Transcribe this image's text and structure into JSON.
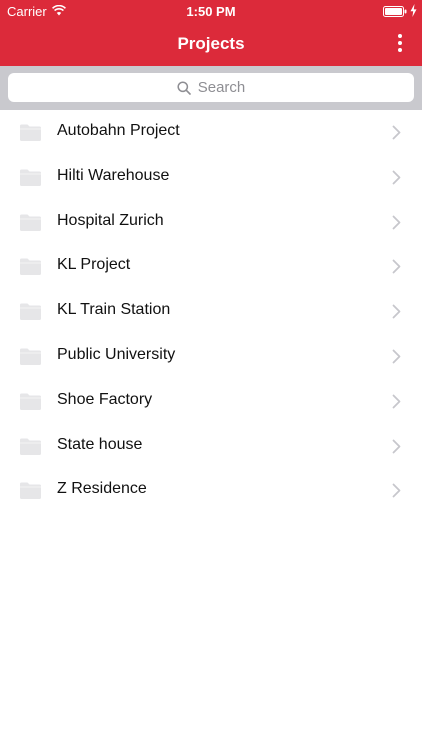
{
  "status_bar": {
    "carrier": "Carrier",
    "time": "1:50 PM"
  },
  "nav": {
    "title": "Projects",
    "more_icon": "more-vertical-icon"
  },
  "search": {
    "placeholder": "Search"
  },
  "projects": [
    {
      "label": "Autobahn Project"
    },
    {
      "label": "Hilti Warehouse"
    },
    {
      "label": "Hospital Zurich"
    },
    {
      "label": "KL Project"
    },
    {
      "label": "KL Train Station"
    },
    {
      "label": "Public University"
    },
    {
      "label": "Shoe Factory"
    },
    {
      "label": "State house"
    },
    {
      "label": "Z Residence"
    }
  ],
  "colors": {
    "accent": "#dc2a3a",
    "search_bg": "#c9c9ce",
    "icon_gray": "#e6e6e8",
    "chevron": "#c7c7cc"
  }
}
